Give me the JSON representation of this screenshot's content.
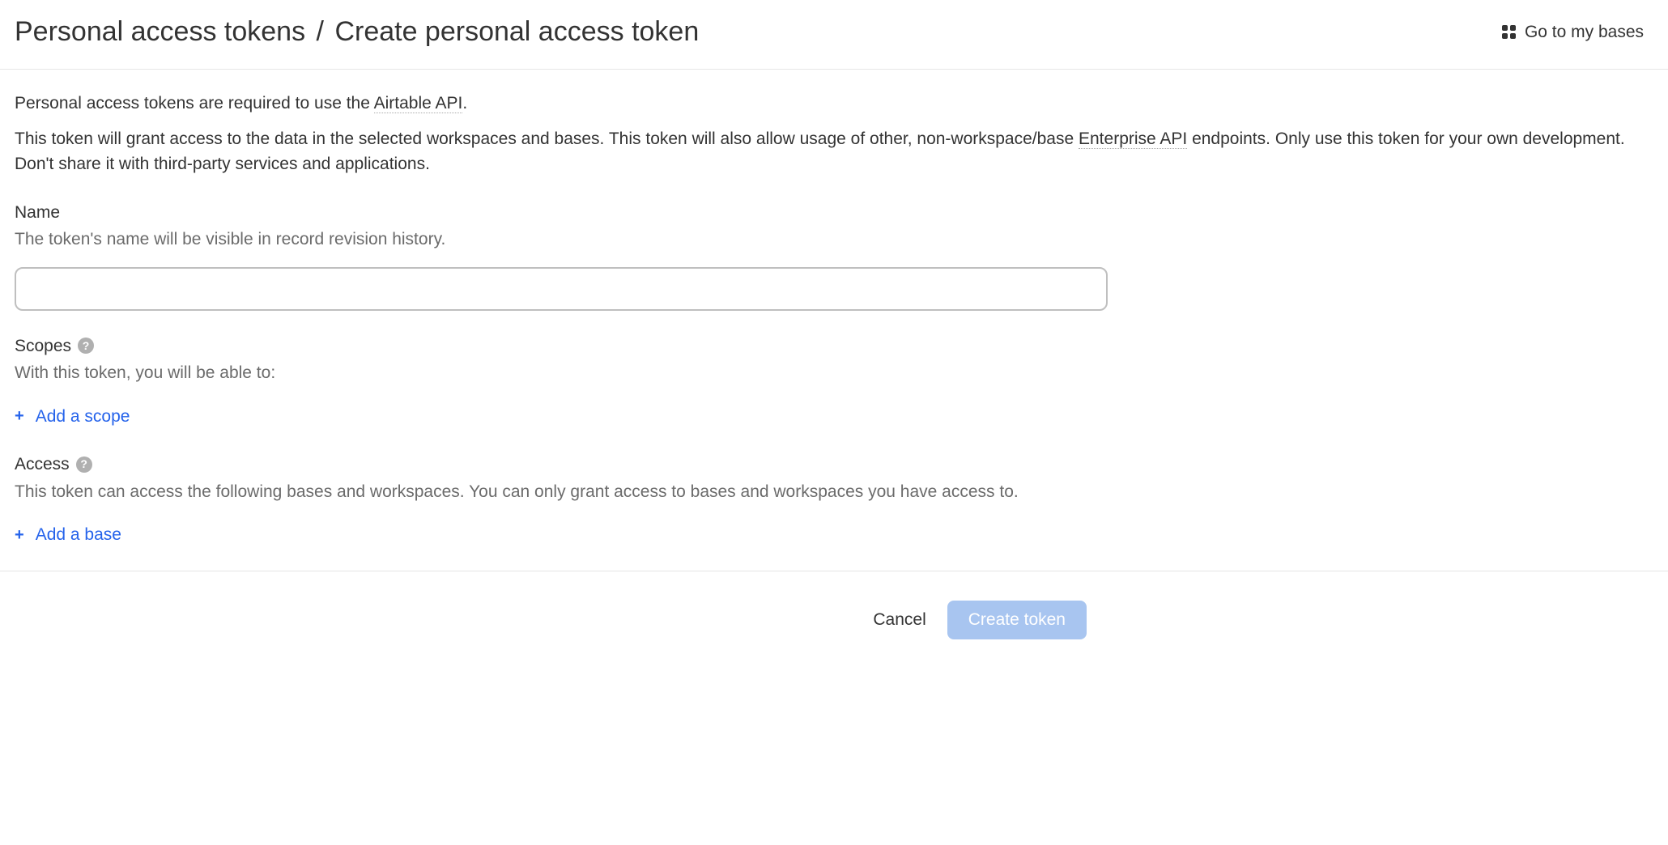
{
  "header": {
    "breadcrumb_parent": "Personal access tokens",
    "breadcrumb_separator": "/",
    "breadcrumb_current": "Create personal access token",
    "go_to_bases": "Go to my bases"
  },
  "intro": {
    "p1_prefix": "Personal access tokens are required to use the ",
    "p1_link": "Airtable API",
    "p1_suffix": ".",
    "p2_prefix": "This token will grant access to the data in the selected workspaces and bases. This token will also allow usage of other, non-workspace/base ",
    "p2_link": "Enterprise API",
    "p2_suffix": " endpoints. Only use this token for your own development. Don't share it with third-party services and applications."
  },
  "name": {
    "label": "Name",
    "help": "The token's name will be visible in record revision history.",
    "value": ""
  },
  "scopes": {
    "label": "Scopes",
    "help": "With this token, you will be able to:",
    "add_label": "Add a scope"
  },
  "access": {
    "label": "Access",
    "help": "This token can access the following bases and workspaces. You can only grant access to bases and workspaces you have access to.",
    "add_label": "Add a base"
  },
  "footer": {
    "cancel": "Cancel",
    "create": "Create token"
  }
}
